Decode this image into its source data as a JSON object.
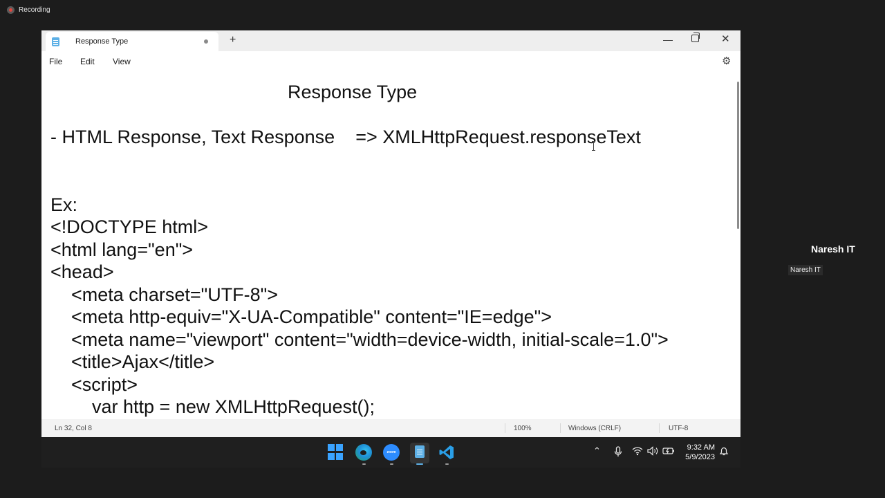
{
  "recording": {
    "label": "Recording"
  },
  "participant": {
    "name": "Naresh IT",
    "tag": "Naresh IT"
  },
  "window": {
    "tab_title": "Response Type",
    "new_tab": "+",
    "minimize": "—",
    "close": "✕"
  },
  "menu": {
    "file": "File",
    "edit": "Edit",
    "view": "View"
  },
  "editor": {
    "heading": "Response Type",
    "lines": [
      "- HTML Response, Text Response    => XMLHttpRequest.responseText",
      "Ex:",
      "<!DOCTYPE html>",
      "<html lang=\"en\">",
      "<head>",
      "    <meta charset=\"UTF-8\">",
      "    <meta http-equiv=\"X-UA-Compatible\" content=\"IE=edge\">",
      "    <meta name=\"viewport\" content=\"width=device-width, initial-scale=1.0\">",
      "    <title>Ajax</title>",
      "    <script>",
      "        var http = new XMLHttpRequest();"
    ]
  },
  "status": {
    "position": "Ln 32, Col 8",
    "zoom": "100%",
    "line_ending": "Windows (CRLF)",
    "encoding": "UTF-8"
  },
  "taskbar": {
    "zoom_label": "zoom",
    "time": "9:32 AM",
    "date": "5/9/2023"
  }
}
